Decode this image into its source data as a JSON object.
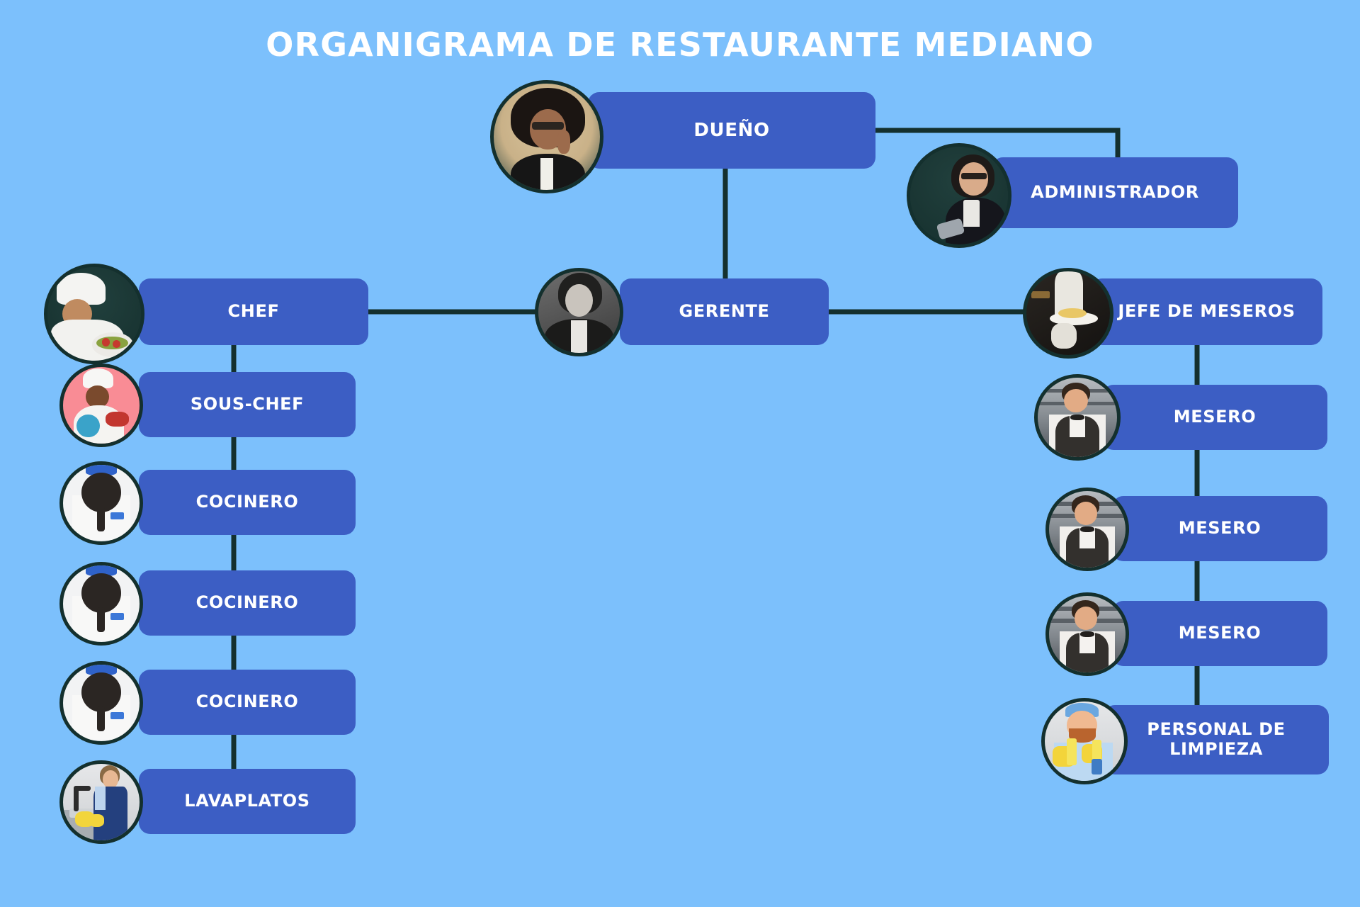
{
  "title": "ORGANIGRAMA DE RESTAURANTE MEDIANO",
  "colors": {
    "background": "#7cc0fc",
    "node_fill": "#3c5ec4",
    "connector": "#14302e",
    "avatar_ring": "#14302e",
    "title_text": "#ffffff",
    "node_text": "#ffffff"
  },
  "nodes": {
    "dueno": {
      "label": "DUEÑO",
      "avatar": "woman-curly-hair-phone-portrait"
    },
    "administrador": {
      "label": "ADMINISTRADOR",
      "avatar": "woman-glasses-tablet-portrait"
    },
    "gerente": {
      "label": "GERENTE",
      "avatar": "woman-blazer-bw-portrait"
    },
    "chef": {
      "label": "CHEF",
      "avatar": "chef-plating-dish-portrait"
    },
    "sous_chef": {
      "label": "SOUS-CHEF",
      "avatar": "cook-pink-background-portrait"
    },
    "cocinero_1": {
      "label": "COCINERO",
      "avatar": "cook-holding-pan-portrait"
    },
    "cocinero_2": {
      "label": "COCINERO",
      "avatar": "cook-holding-pan-portrait"
    },
    "cocinero_3": {
      "label": "COCINERO",
      "avatar": "cook-holding-pan-portrait"
    },
    "lavaplatos": {
      "label": "LAVAPLATOS",
      "avatar": "dishwasher-at-sink-portrait"
    },
    "jefe_meseros": {
      "label": "JEFE DE MESEROS",
      "avatar": "waiter-serving-plate-portrait"
    },
    "mesero_1": {
      "label": "MESERO",
      "avatar": "waiter-bowtie-vest-portrait"
    },
    "mesero_2": {
      "label": "MESERO",
      "avatar": "waiter-bowtie-vest-portrait"
    },
    "mesero_3": {
      "label": "MESERO",
      "avatar": "waiter-bowtie-vest-portrait"
    },
    "limpieza": {
      "label": "PERSONAL DE LIMPIEZA",
      "avatar": "cleaner-gloves-spray-portrait"
    }
  },
  "hierarchy": [
    {
      "parent": "dueno",
      "child": "administrador"
    },
    {
      "parent": "dueno",
      "child": "gerente"
    },
    {
      "parent": "gerente",
      "child": "chef"
    },
    {
      "parent": "gerente",
      "child": "jefe_meseros"
    },
    {
      "parent": "chef",
      "child": "sous_chef"
    },
    {
      "parent": "chef",
      "child": "cocinero_1"
    },
    {
      "parent": "chef",
      "child": "cocinero_2"
    },
    {
      "parent": "chef",
      "child": "cocinero_3"
    },
    {
      "parent": "chef",
      "child": "lavaplatos"
    },
    {
      "parent": "jefe_meseros",
      "child": "mesero_1"
    },
    {
      "parent": "jefe_meseros",
      "child": "mesero_2"
    },
    {
      "parent": "jefe_meseros",
      "child": "mesero_3"
    },
    {
      "parent": "jefe_meseros",
      "child": "limpieza"
    }
  ]
}
